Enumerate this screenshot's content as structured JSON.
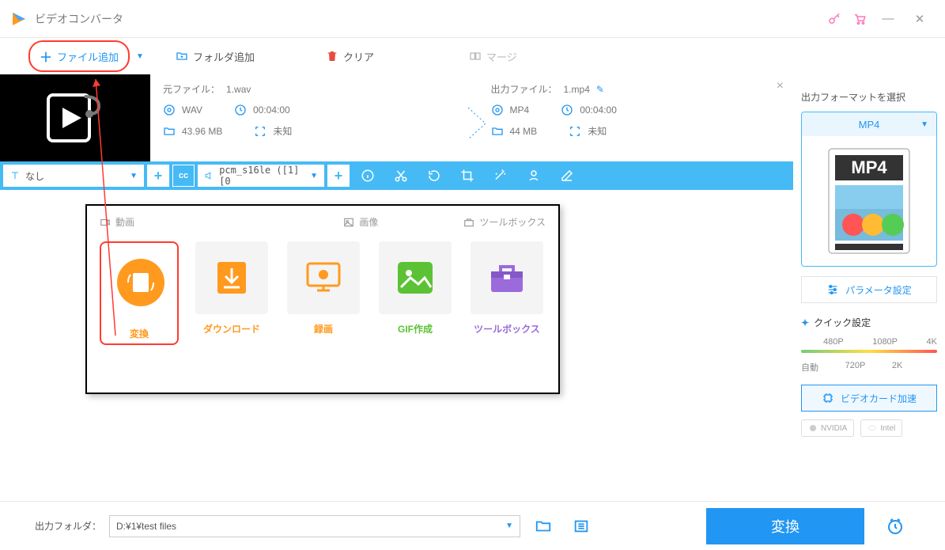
{
  "app": {
    "title": "ビデオコンバータ"
  },
  "toolbar": {
    "add_file": "ファイル追加",
    "add_folder": "フォルダ追加",
    "clear": "クリア",
    "merge": "マージ"
  },
  "file": {
    "source_label": "元ファイル：",
    "source_name": "1.wav",
    "output_label": "出力ファイル：",
    "output_name": "1.mp4",
    "src_format": "WAV",
    "src_duration": "00:04:00",
    "src_size": "43.96 MB",
    "src_resolution": "未知",
    "out_format": "MP4",
    "out_duration": "00:04:00",
    "out_size": "44 MB",
    "out_resolution": "未知"
  },
  "actionbar": {
    "subtitle_none": "なし",
    "audio_codec": "pcm_s16le ([1][0"
  },
  "panel": {
    "tab_video": "動画",
    "tab_image": "画像",
    "tab_toolbox": "ツールボックス",
    "items": [
      {
        "label": "変換",
        "color": "#ff9a1f"
      },
      {
        "label": "ダウンロード",
        "color": "#ff9a1f"
      },
      {
        "label": "録画",
        "color": "#ff9a1f"
      },
      {
        "label": "GIF作成",
        "color": "#5bc236"
      },
      {
        "label": "ツールボックス",
        "color": "#9b6bdc"
      }
    ]
  },
  "sidebar": {
    "title": "出力フォーマットを選択",
    "format": "MP4",
    "param_btn": "パラメータ設定",
    "quick_title": "クイック設定",
    "scale": {
      "p480": "480P",
      "p720": "720P",
      "p1080": "1080P",
      "p2k": "2K",
      "p4k": "4K",
      "auto": "自動"
    },
    "gpu_btn": "ビデオカード加速",
    "chips": {
      "nvidia": "NVIDIA",
      "intel": "Intel"
    }
  },
  "footer": {
    "label": "出力フォルダ：",
    "path": "D:¥1¥test files",
    "convert": "変換"
  }
}
